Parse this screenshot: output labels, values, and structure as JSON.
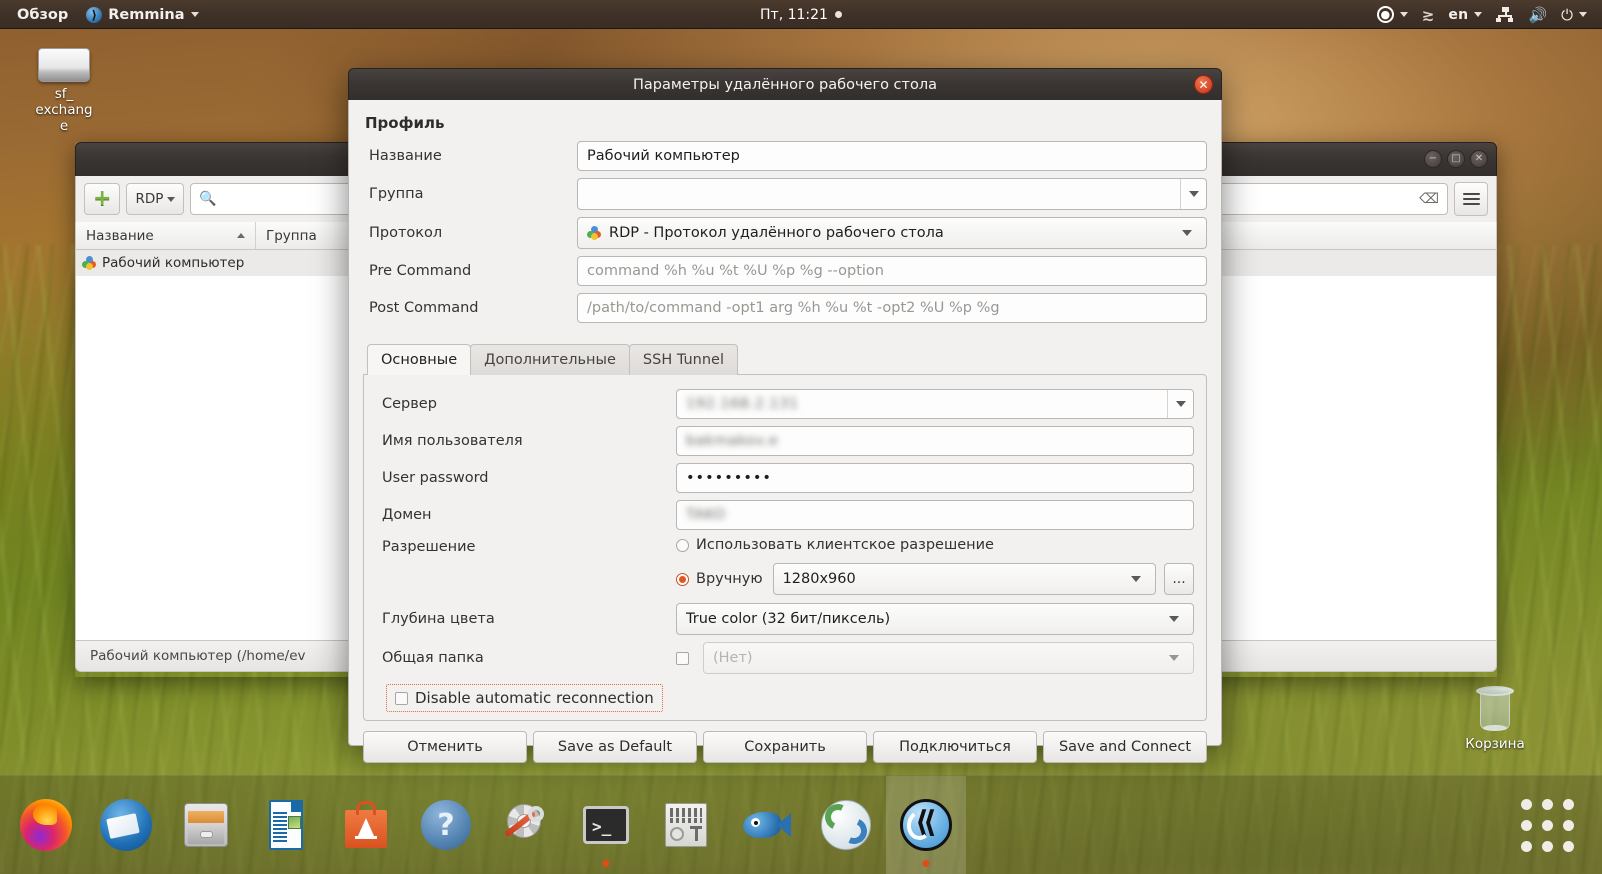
{
  "topbar": {
    "activities": "Обзор",
    "app_name": "Remmina",
    "clock": "Пт, 11:21",
    "accessibility_icon": "accessibility-icon",
    "ime_icon": "input-method-icon",
    "language": "en",
    "network_icon": "network-icon",
    "volume_icon": "volume-icon",
    "power_icon": "power-icon"
  },
  "desktop": {
    "icons": [
      {
        "label": "sf_\nexchang\ne",
        "icon": "drive-icon"
      },
      {
        "label": "Корзина",
        "icon": "trash-icon"
      }
    ]
  },
  "remmina_window": {
    "toolbar": {
      "add_label": "",
      "protocol_label": "RDP",
      "search_placeholder": ""
    },
    "columns": [
      "Название",
      "Группа"
    ],
    "rows": [
      {
        "name": "Рабочий компьютер",
        "group": ""
      }
    ],
    "statusbar": "Рабочий компьютер (/home/ev"
  },
  "dialog": {
    "title": "Параметры удалённого рабочего стола",
    "close_label": "✕",
    "profile": {
      "section_title": "Профиль",
      "fields": [
        {
          "label": "Название",
          "value": "Рабочий компьютер",
          "type": "text"
        },
        {
          "label": "Группа",
          "value": "",
          "type": "combo"
        },
        {
          "label": "Протокол",
          "value": "RDP - Протокол удалённого рабочего стола",
          "type": "combo"
        },
        {
          "label": "Pre Command",
          "value": "command %h %u %t %U %p %g --option",
          "type": "placeholder"
        },
        {
          "label": "Post Command",
          "value": "/path/to/command -opt1 arg %h %u %t -opt2 %U %p %g",
          "type": "placeholder"
        }
      ]
    },
    "tabs": [
      {
        "label": "Основные",
        "active": true
      },
      {
        "label": "Дополнительные",
        "active": false
      },
      {
        "label": "SSH Tunnel",
        "active": false
      }
    ],
    "basic": {
      "server_label": "Сервер",
      "server_value": "192.168.2.131",
      "username_label": "Имя пользователя",
      "username_value": "bakmakov.e",
      "password_label": "User password",
      "password_value": "•••••••••",
      "domain_label": "Домен",
      "domain_value": "TAKO",
      "resolution_label": "Разрешение",
      "resolution_client_option": "Использовать клиентское разрешение",
      "resolution_manual_option": "Вручную",
      "resolution_value": "1280x960",
      "resolution_more_button": "...",
      "colordepth_label": "Глубина цвета",
      "colordepth_value": "True color (32 бит/пиксель)",
      "sharefolder_label": "Общая папка",
      "sharefolder_value": "(Нет)",
      "disable_reconnect_label": "Disable automatic reconnection"
    },
    "buttons": [
      "Отменить",
      "Save as Default",
      "Сохранить",
      "Подключиться",
      "Save and Connect"
    ]
  },
  "dock": {
    "items": [
      {
        "name": "firefox",
        "running": false
      },
      {
        "name": "thunderbird",
        "running": false
      },
      {
        "name": "file-manager",
        "running": false
      },
      {
        "name": "libreoffice-writer",
        "running": false
      },
      {
        "name": "ubuntu-software",
        "running": false
      },
      {
        "name": "help",
        "running": false
      },
      {
        "name": "settings-tweaks",
        "running": false
      },
      {
        "name": "terminal",
        "running": true
      },
      {
        "name": "dconf-editor",
        "running": false
      },
      {
        "name": "bluefish",
        "running": false
      },
      {
        "name": "web-browser",
        "running": true
      },
      {
        "name": "remmina",
        "running": true
      }
    ],
    "apps_button": "show-applications"
  },
  "colors": {
    "accent": "#e2561f",
    "panel": "#3e3027",
    "dialog_bg": "#f2f1ef",
    "focus_outline": "#d4703a"
  }
}
